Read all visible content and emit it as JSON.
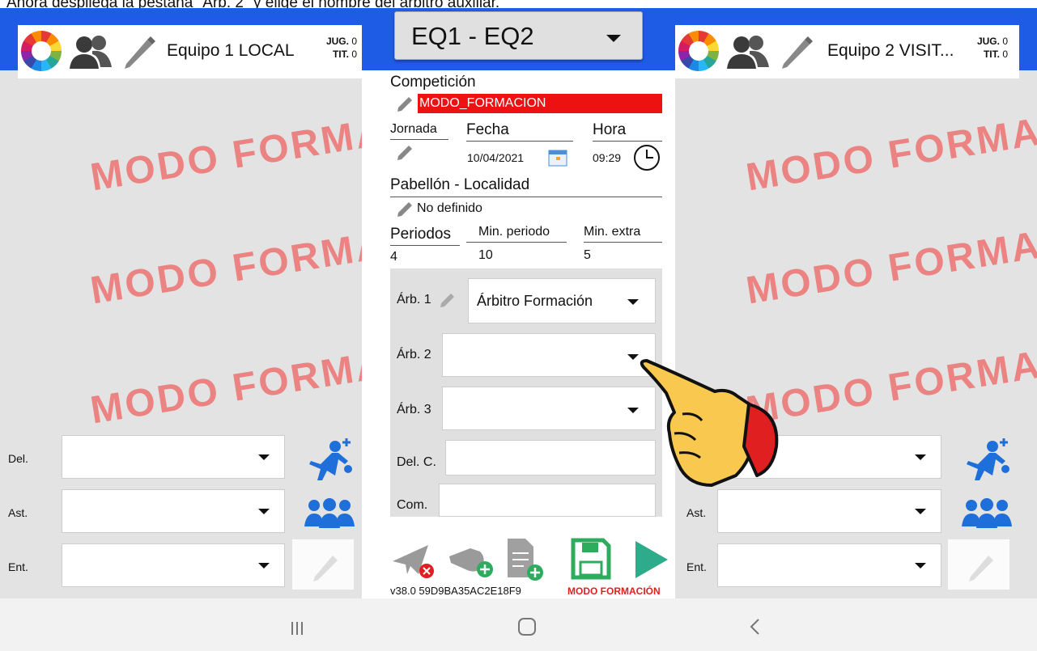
{
  "caption": "Ahora despliega la pestaña \"Árb. 2\" y elige el nombre del árbitro auxiliar.",
  "colors": {
    "header_blue": "#1f5ce6",
    "red": "#ee1111",
    "player_icon": "#1e6fd9",
    "watermark": "#f05050"
  },
  "left_panel": {
    "team_name": "Equipo 1 LOCAL",
    "jug_label": "JUG.",
    "jug_value": "0",
    "tit_label": "TIT.",
    "tit_value": "0",
    "watermark": "MODO FORMA",
    "rows": {
      "del": "Del.",
      "ast": "Ast.",
      "ent": "Ent."
    },
    "icons": [
      "color-wheel-icon",
      "team-users-icon",
      "pencil-icon",
      "add-player-icon",
      "group-icon"
    ]
  },
  "right_panel": {
    "team_name": "Equipo 2 VISIT...",
    "jug_label": "JUG.",
    "jug_value": "0",
    "tit_label": "TIT.",
    "tit_value": "0",
    "watermark": "MODO FORMA",
    "rows": {
      "ast": "Ast.",
      "ent": "Ent."
    }
  },
  "center": {
    "match_selector": "EQ1 - EQ2",
    "competition_label": "Competición",
    "competition_value": "MODO_FORMACION",
    "jornada_label": "Jornada",
    "fecha_label": "Fecha",
    "fecha_value": "10/04/2021",
    "hora_label": "Hora",
    "hora_value": "09:29",
    "pabellon_label": "Pabellón - Localidad",
    "pabellon_value": "No definido",
    "periodos_label": "Periodos",
    "periodos_value": "4",
    "min_periodo_label": "Min. periodo",
    "min_periodo_value": "10",
    "min_extra_label": "Min. extra",
    "min_extra_value": "5",
    "arb1_label": "Árb. 1",
    "arb1_value": "Árbitro Formación",
    "arb2_label": "Árb. 2",
    "arb2_value": "",
    "arb3_label": "Árb. 3",
    "arb3_value": "",
    "delc_label": "Del. C.",
    "com_label": "Com.",
    "version": "v38.0  59D9BA35AC2E18F9",
    "mode": "MODO FORMACIÓN"
  }
}
